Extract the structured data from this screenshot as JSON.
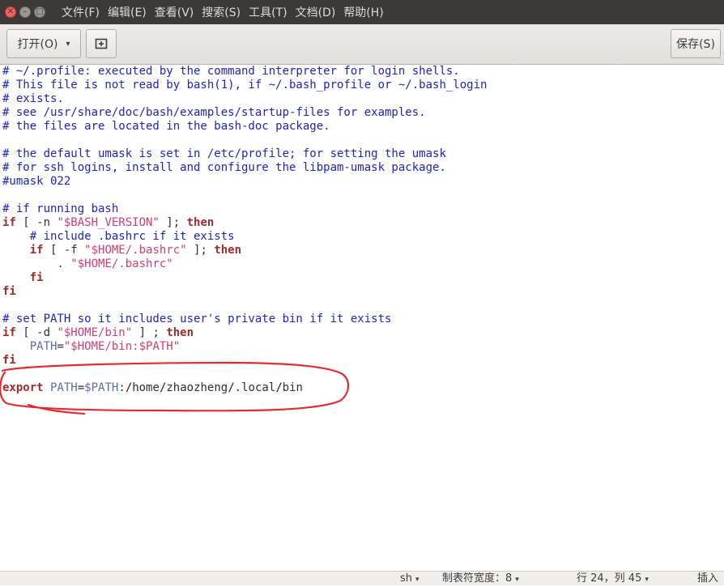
{
  "window": {
    "controls": [
      "close-icon",
      "minimize-icon",
      "maximize-icon"
    ],
    "menu": [
      "文件(F)",
      "编辑(E)",
      "查看(V)",
      "搜索(S)",
      "工具(T)",
      "文档(D)",
      "帮助(H)"
    ]
  },
  "toolbar": {
    "open_label": "打开(O)",
    "open_caret": "▾",
    "new_tab_icon": "new-document-icon",
    "save_label": "保存(S)"
  },
  "editor": {
    "lines": [
      [
        [
          "c",
          "# ~/.profile: executed by the command interpreter for login shells."
        ]
      ],
      [
        [
          "c",
          "# This file is not read by bash(1), if ~/.bash_profile or ~/.bash_login"
        ]
      ],
      [
        [
          "c",
          "# exists."
        ]
      ],
      [
        [
          "c",
          "# see /usr/share/doc/bash/examples/startup-files for examples."
        ]
      ],
      [
        [
          "c",
          "# the files are located in the bash-doc package."
        ]
      ],
      [],
      [
        [
          "c",
          "# the default umask is set in /etc/profile; for setting the umask"
        ]
      ],
      [
        [
          "c",
          "# for ssh logins, install and configure the libpam-umask package."
        ]
      ],
      [
        [
          "c",
          "#umask 022"
        ]
      ],
      [],
      [
        [
          "c",
          "# if running bash"
        ]
      ],
      [
        [
          "k",
          "if"
        ],
        [
          "t",
          " [ -n "
        ],
        [
          "s",
          "\"$BASH_VERSION\""
        ],
        [
          "t",
          " ]; "
        ],
        [
          "k",
          "then"
        ]
      ],
      [
        [
          "t",
          "    "
        ],
        [
          "c",
          "# include .bashrc if it exists"
        ]
      ],
      [
        [
          "t",
          "    "
        ],
        [
          "k",
          "if"
        ],
        [
          "t",
          " [ -f "
        ],
        [
          "s",
          "\"$HOME/.bashrc\""
        ],
        [
          "t",
          " ]; "
        ],
        [
          "k",
          "then"
        ]
      ],
      [
        [
          "t",
          "        . "
        ],
        [
          "s",
          "\"$HOME/.bashrc\""
        ]
      ],
      [
        [
          "t",
          "    "
        ],
        [
          "k",
          "fi"
        ]
      ],
      [
        [
          "k",
          "fi"
        ]
      ],
      [],
      [
        [
          "c",
          "# set PATH so it includes user's private bin if it exists"
        ]
      ],
      [
        [
          "k",
          "if"
        ],
        [
          "t",
          " [ -d "
        ],
        [
          "s",
          "\"$HOME/bin\""
        ],
        [
          "t",
          " ] ; "
        ],
        [
          "k",
          "then"
        ]
      ],
      [
        [
          "t",
          "    "
        ],
        [
          "p",
          "PATH"
        ],
        [
          "t",
          "="
        ],
        [
          "s",
          "\"$HOME/bin:$PATH\""
        ]
      ],
      [
        [
          "k",
          "fi"
        ]
      ],
      [],
      [
        [
          "k",
          "export"
        ],
        [
          "t",
          " "
        ],
        [
          "p",
          "PATH"
        ],
        [
          "t",
          "="
        ],
        [
          "v",
          "$PATH"
        ],
        [
          "t",
          ":"
        ],
        [
          "sep",
          "/"
        ],
        [
          "t",
          "home"
        ],
        [
          "sep",
          "/"
        ],
        [
          "t",
          "zhaozheng"
        ],
        [
          "sep",
          "/"
        ],
        [
          "t",
          ".local"
        ],
        [
          "sep",
          "/"
        ],
        [
          "t",
          "bin"
        ]
      ]
    ],
    "annotation_color": "#e8292b"
  },
  "status": {
    "language": "sh",
    "tab_width": "制表符宽度：8",
    "position": "行 24，列 45",
    "mode": "插入"
  }
}
